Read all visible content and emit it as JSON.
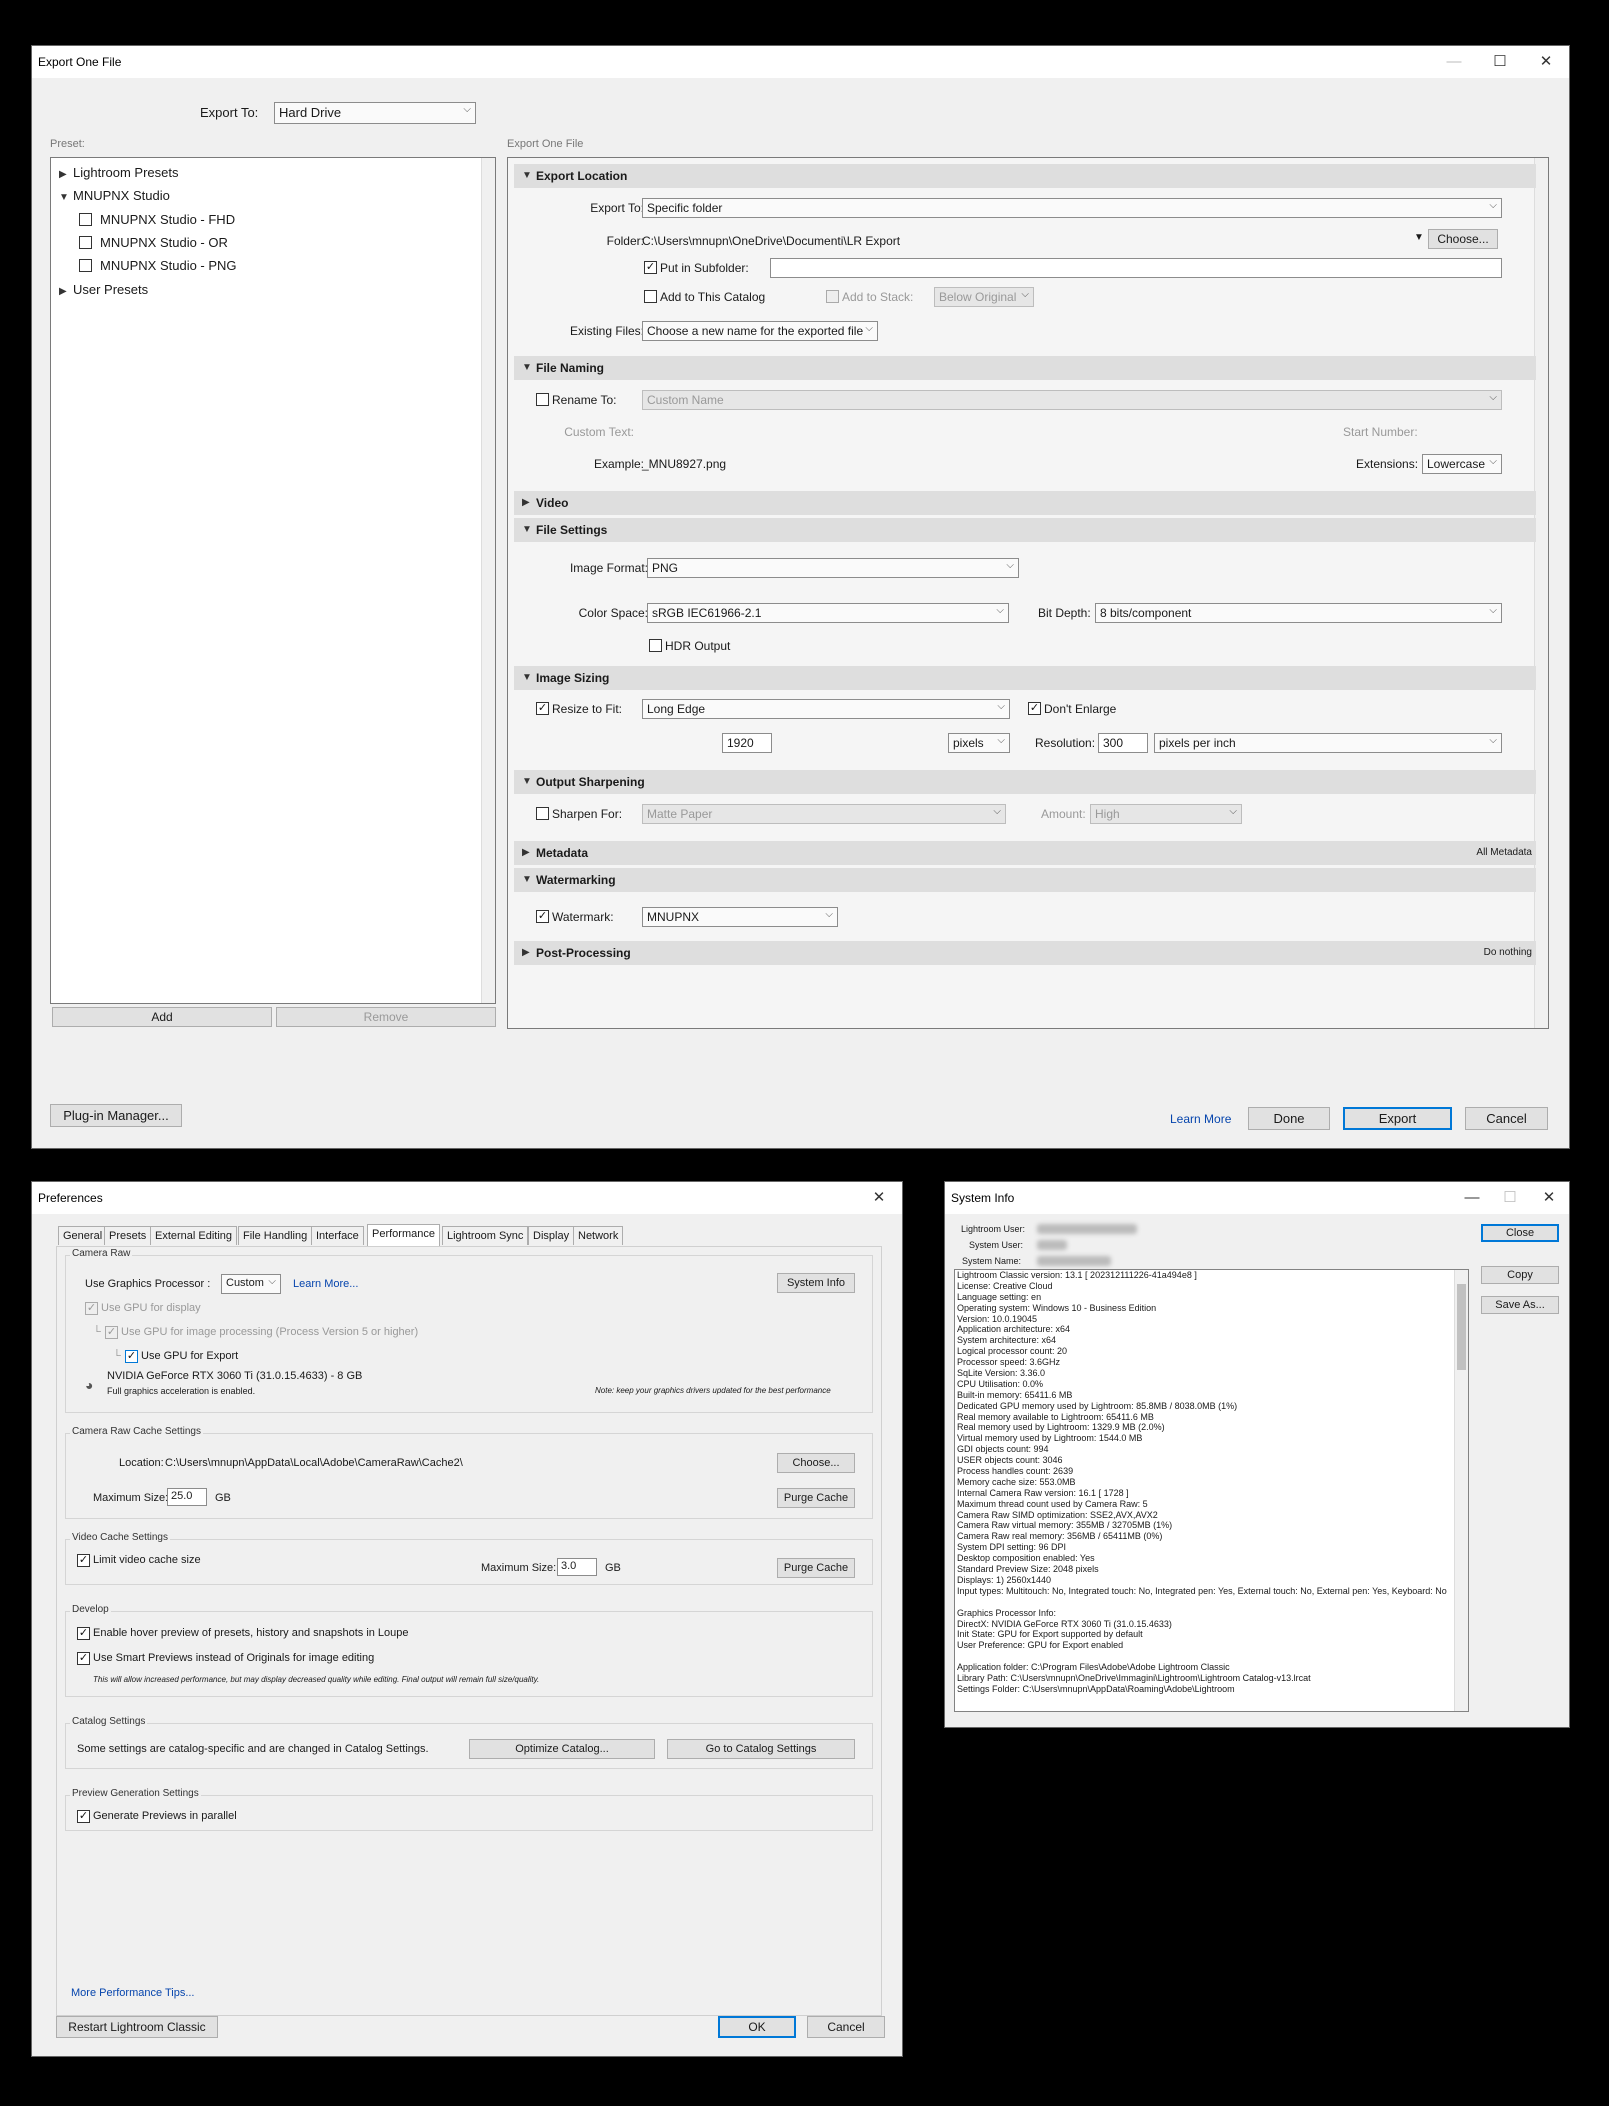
{
  "export_dialog": {
    "title": "Export One File",
    "export_to_label": "Export To:",
    "export_to_value": "Hard Drive",
    "preset_label": "Preset:",
    "right_label": "Export One File",
    "presets": {
      "lightroom": "Lightroom Presets",
      "studio": "MNUPNX Studio",
      "fhd": "MNUPNX Studio - FHD",
      "or": "MNUPNX Studio - OR",
      "png": "MNUPNX Studio - PNG",
      "user": "User Presets"
    },
    "add": "Add",
    "remove": "Remove",
    "plugin": "Plug-in Manager...",
    "learn_more": "Learn More",
    "done": "Done",
    "export": "Export",
    "cancel": "Cancel",
    "location": {
      "header": "Export Location",
      "export_to_label": "Export To:",
      "export_to_value": "Specific folder",
      "folder_label": "Folder:",
      "folder_value": "C:\\Users\\mnupn\\OneDrive\\Documenti\\LR Export",
      "choose": "Choose...",
      "subfolder_label": "Put in Subfolder:",
      "subfolder_value": "",
      "add_catalog": "Add to This Catalog",
      "add_stack": "Add to Stack:",
      "below_original": "Below Original",
      "existing_label": "Existing Files:",
      "existing_value": "Choose a new name for the exported file"
    },
    "naming": {
      "header": "File Naming",
      "rename_label": "Rename To:",
      "rename_value": "Custom Name",
      "custom_text": "Custom Text:",
      "start_number": "Start Number:",
      "example_label": "Example:",
      "example_value": "_MNU8927.png",
      "extensions_label": "Extensions:",
      "extensions_value": "Lowercase"
    },
    "video": {
      "header": "Video"
    },
    "file_settings": {
      "header": "File Settings",
      "format_label": "Image Format:",
      "format_value": "PNG",
      "color_label": "Color Space:",
      "color_value": "sRGB IEC61966-2.1",
      "depth_label": "Bit Depth:",
      "depth_value": "8 bits/component",
      "hdr": "HDR Output"
    },
    "sizing": {
      "header": "Image Sizing",
      "resize_label": "Resize to Fit:",
      "resize_value": "Long Edge",
      "dont_enlarge": "Don't Enlarge",
      "size_value": "1920",
      "unit_value": "pixels",
      "resolution_label": "Resolution:",
      "resolution_value": "300",
      "res_unit_value": "pixels per inch"
    },
    "sharpening": {
      "header": "Output Sharpening",
      "sharpen_label": "Sharpen For:",
      "sharpen_value": "Matte Paper",
      "amount_label": "Amount:",
      "amount_value": "High"
    },
    "metadata": {
      "header": "Metadata",
      "right": "All Metadata"
    },
    "watermarking": {
      "header": "Watermarking",
      "label": "Watermark:",
      "value": "MNUPNX"
    },
    "post": {
      "header": "Post-Processing",
      "right": "Do nothing"
    }
  },
  "preferences": {
    "title": "Preferences",
    "tabs": [
      "General",
      "Presets",
      "External Editing",
      "File Handling",
      "Interface",
      "Performance",
      "Lightroom Sync",
      "Display",
      "Network"
    ],
    "camera_raw": {
      "group": "Camera Raw",
      "use_gp_label": "Use Graphics Processor :",
      "use_gp_value": "Custom",
      "learn_more": "Learn More...",
      "system_info": "System Info",
      "gpu_display": "Use GPU for display",
      "gpu_processing": "Use GPU for image processing (Process Version 5 or higher)",
      "gpu_export": "Use GPU for Export",
      "gpu_name": "NVIDIA GeForce RTX 3060 Ti (31.0.15.4633) - 8 GB",
      "accel": "Full graphics acceleration is enabled.",
      "note": "Note: keep your graphics drivers updated for the best performance"
    },
    "cache": {
      "group": "Camera Raw Cache Settings",
      "location_label": "Location:",
      "location_value": "C:\\Users\\mnupn\\AppData\\Local\\Adobe\\CameraRaw\\Cache2\\",
      "choose": "Choose...",
      "max_label": "Maximum Size:",
      "max_value": "25.0",
      "unit": "GB",
      "purge": "Purge Cache"
    },
    "video_cache": {
      "group": "Video Cache Settings",
      "limit": "Limit video cache size",
      "max_label": "Maximum Size:",
      "max_value": "3.0",
      "unit": "GB",
      "purge": "Purge Cache"
    },
    "develop": {
      "group": "Develop",
      "hover": "Enable hover preview of presets, history and snapshots in Loupe",
      "smart": "Use Smart Previews instead of Originals for image editing",
      "note": "This will allow increased performance, but may display decreased quality while editing. Final output will remain full size/quality."
    },
    "catalog": {
      "group": "Catalog Settings",
      "text": "Some settings are catalog-specific and are changed in Catalog Settings.",
      "optimize": "Optimize Catalog...",
      "goto": "Go to Catalog Settings"
    },
    "preview": {
      "group": "Preview Generation Settings",
      "parallel": "Generate Previews in parallel"
    },
    "more_tips": "More Performance Tips...",
    "restart": "Restart Lightroom Classic",
    "ok": "OK",
    "cancel": "Cancel"
  },
  "sysinfo": {
    "title": "System Info",
    "lr_user": "Lightroom User:",
    "sys_user": "System User:",
    "sys_name": "System Name:",
    "close": "Close",
    "copy": "Copy",
    "save_as": "Save As...",
    "lines": [
      "Lightroom Classic version: 13.1 [ 202312111226-41a494e8 ]",
      "License: Creative Cloud",
      "Language setting: en",
      "Operating system: Windows 10 - Business Edition",
      "Version: 10.0.19045",
      "Application architecture: x64",
      "System architecture: x64",
      "Logical processor count: 20",
      "Processor speed: 3.6GHz",
      "SqLite Version: 3.36.0",
      "CPU Utilisation: 0.0%",
      "Built-in memory: 65411.6 MB",
      "Dedicated GPU memory used by Lightroom: 85.8MB / 8038.0MB (1%)",
      "Real memory available to Lightroom: 65411.6 MB",
      "Real memory used by Lightroom: 1329.9 MB (2.0%)",
      "Virtual memory used by Lightroom: 1544.0 MB",
      "GDI objects count: 994",
      "USER objects count: 3046",
      "Process handles count: 2639",
      "Memory cache size: 553.0MB",
      "Internal Camera Raw version: 16.1 [ 1728 ]",
      "Maximum thread count used by Camera Raw: 5",
      "Camera Raw SIMD optimization: SSE2,AVX,AVX2",
      "Camera Raw virtual memory: 355MB / 32705MB (1%)",
      "Camera Raw real memory: 356MB / 65411MB (0%)",
      "System DPI setting: 96 DPI",
      "Desktop composition enabled: Yes",
      "Standard Preview Size: 2048 pixels",
      "Displays: 1) 2560x1440",
      "Input types: Multitouch: No, Integrated touch: No, Integrated pen: Yes, External touch: No, External pen: Yes, Keyboard: No",
      "",
      "Graphics Processor Info:",
      "DirectX: NVIDIA GeForce RTX 3060 Ti (31.0.15.4633)",
      "Init State: GPU for Export supported by default",
      "User Preference: GPU for Export enabled",
      "",
      "Application folder: C:\\Program Files\\Adobe\\Adobe Lightroom Classic",
      "Library Path: C:\\Users\\mnupn\\OneDrive\\Immagini\\Lightroom\\Lightroom Catalog-v13.lrcat",
      "Settings Folder: C:\\Users\\mnupn\\AppData\\Roaming\\Adobe\\Lightroom"
    ]
  }
}
